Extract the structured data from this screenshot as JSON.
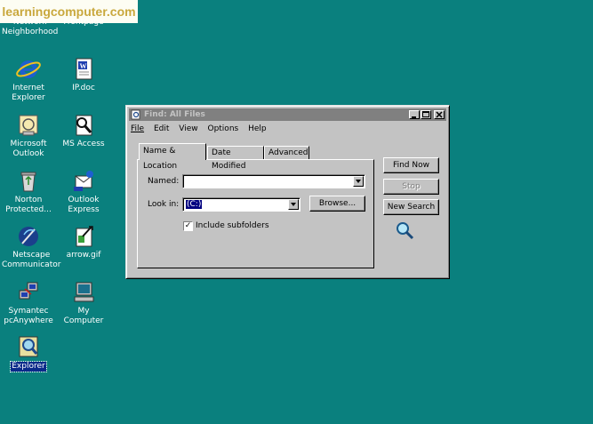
{
  "watermark": "learningcomputer.com",
  "desktop": {
    "icons": [
      {
        "label_lines": [
          "Network",
          "Neighborhood"
        ],
        "icon": "network-neighborhood-icon"
      },
      {
        "label_lines": [
          "Frontpage"
        ],
        "icon": "frontpage-icon"
      },
      {
        "label_lines": [
          "Internet",
          "Explorer"
        ],
        "icon": "internet-explorer-icon"
      },
      {
        "label_lines": [
          "IP.doc"
        ],
        "icon": "word-document-icon"
      },
      {
        "label_lines": [
          "Microsoft",
          "Outlook"
        ],
        "icon": "outlook-icon"
      },
      {
        "label_lines": [
          "MS Access"
        ],
        "icon": "access-icon"
      },
      {
        "label_lines": [
          "Norton",
          "Protected..."
        ],
        "icon": "recycle-bin-icon"
      },
      {
        "label_lines": [
          "Outlook",
          "Express"
        ],
        "icon": "outlook-express-icon"
      },
      {
        "label_lines": [
          "Netscape",
          "Communicator"
        ],
        "icon": "netscape-icon"
      },
      {
        "label_lines": [
          "arrow.gif"
        ],
        "icon": "image-file-icon"
      },
      {
        "label_lines": [
          "Symantec",
          "pcAnywhere"
        ],
        "icon": "pcanywhere-icon"
      },
      {
        "label_lines": [
          "My Computer"
        ],
        "icon": "my-computer-icon"
      },
      {
        "label_lines": [
          "Explorer"
        ],
        "icon": "explorer-icon"
      }
    ]
  },
  "find_window": {
    "title": "Find: All Files",
    "menu": [
      "File",
      "Edit",
      "View",
      "Options",
      "Help"
    ],
    "tabs": [
      "Name & Location",
      "Date Modified",
      "Advanced"
    ],
    "active_tab": "Name & Location",
    "named_label": "Named:",
    "named_value": "",
    "look_in_label": "Look in:",
    "look_in_value": "(C:)",
    "browse_button": "Browse...",
    "include_subfolders_label": "Include subfolders",
    "include_subfolders_checked": true,
    "find_now_button": "Find Now",
    "stop_button": "Stop",
    "new_search_button": "New Search"
  }
}
